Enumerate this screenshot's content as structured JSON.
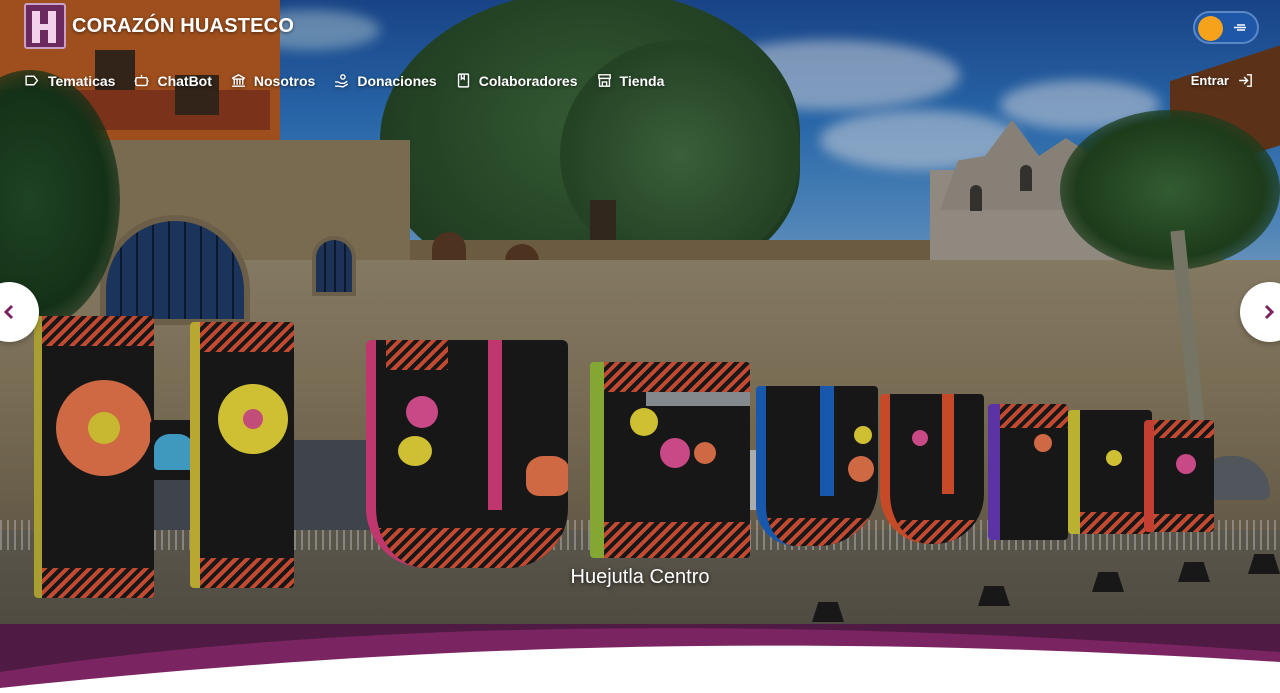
{
  "brand": {
    "name": "CORAZÓN HUASTECO",
    "logo_icon": "corazon-huasteco-logo"
  },
  "nav": {
    "items": [
      {
        "label": "Tematicas",
        "icon": "tag-icon"
      },
      {
        "label": "ChatBot",
        "icon": "robot-icon"
      },
      {
        "label": "Nosotros",
        "icon": "bank-icon"
      },
      {
        "label": "Donaciones",
        "icon": "donation-icon"
      },
      {
        "label": "Colaboradores",
        "icon": "book-icon"
      },
      {
        "label": "Tienda",
        "icon": "store-icon"
      }
    ],
    "login_label": "Entrar",
    "login_icon": "login-icon"
  },
  "theme_toggle": {
    "state": "light",
    "icons": [
      "sun-icon",
      "moon-icon"
    ]
  },
  "carousel": {
    "caption": "Huejutla Centro",
    "prev_icon": "chevron-left-icon",
    "next_icon": "chevron-right-icon"
  },
  "colors": {
    "brand_purple": "#6a2a5e",
    "wave_dark": "#4f1a43",
    "wave_mid": "#7a2561",
    "toggle_blue": "#1e57a8",
    "toggle_sun": "#f7a21b"
  }
}
